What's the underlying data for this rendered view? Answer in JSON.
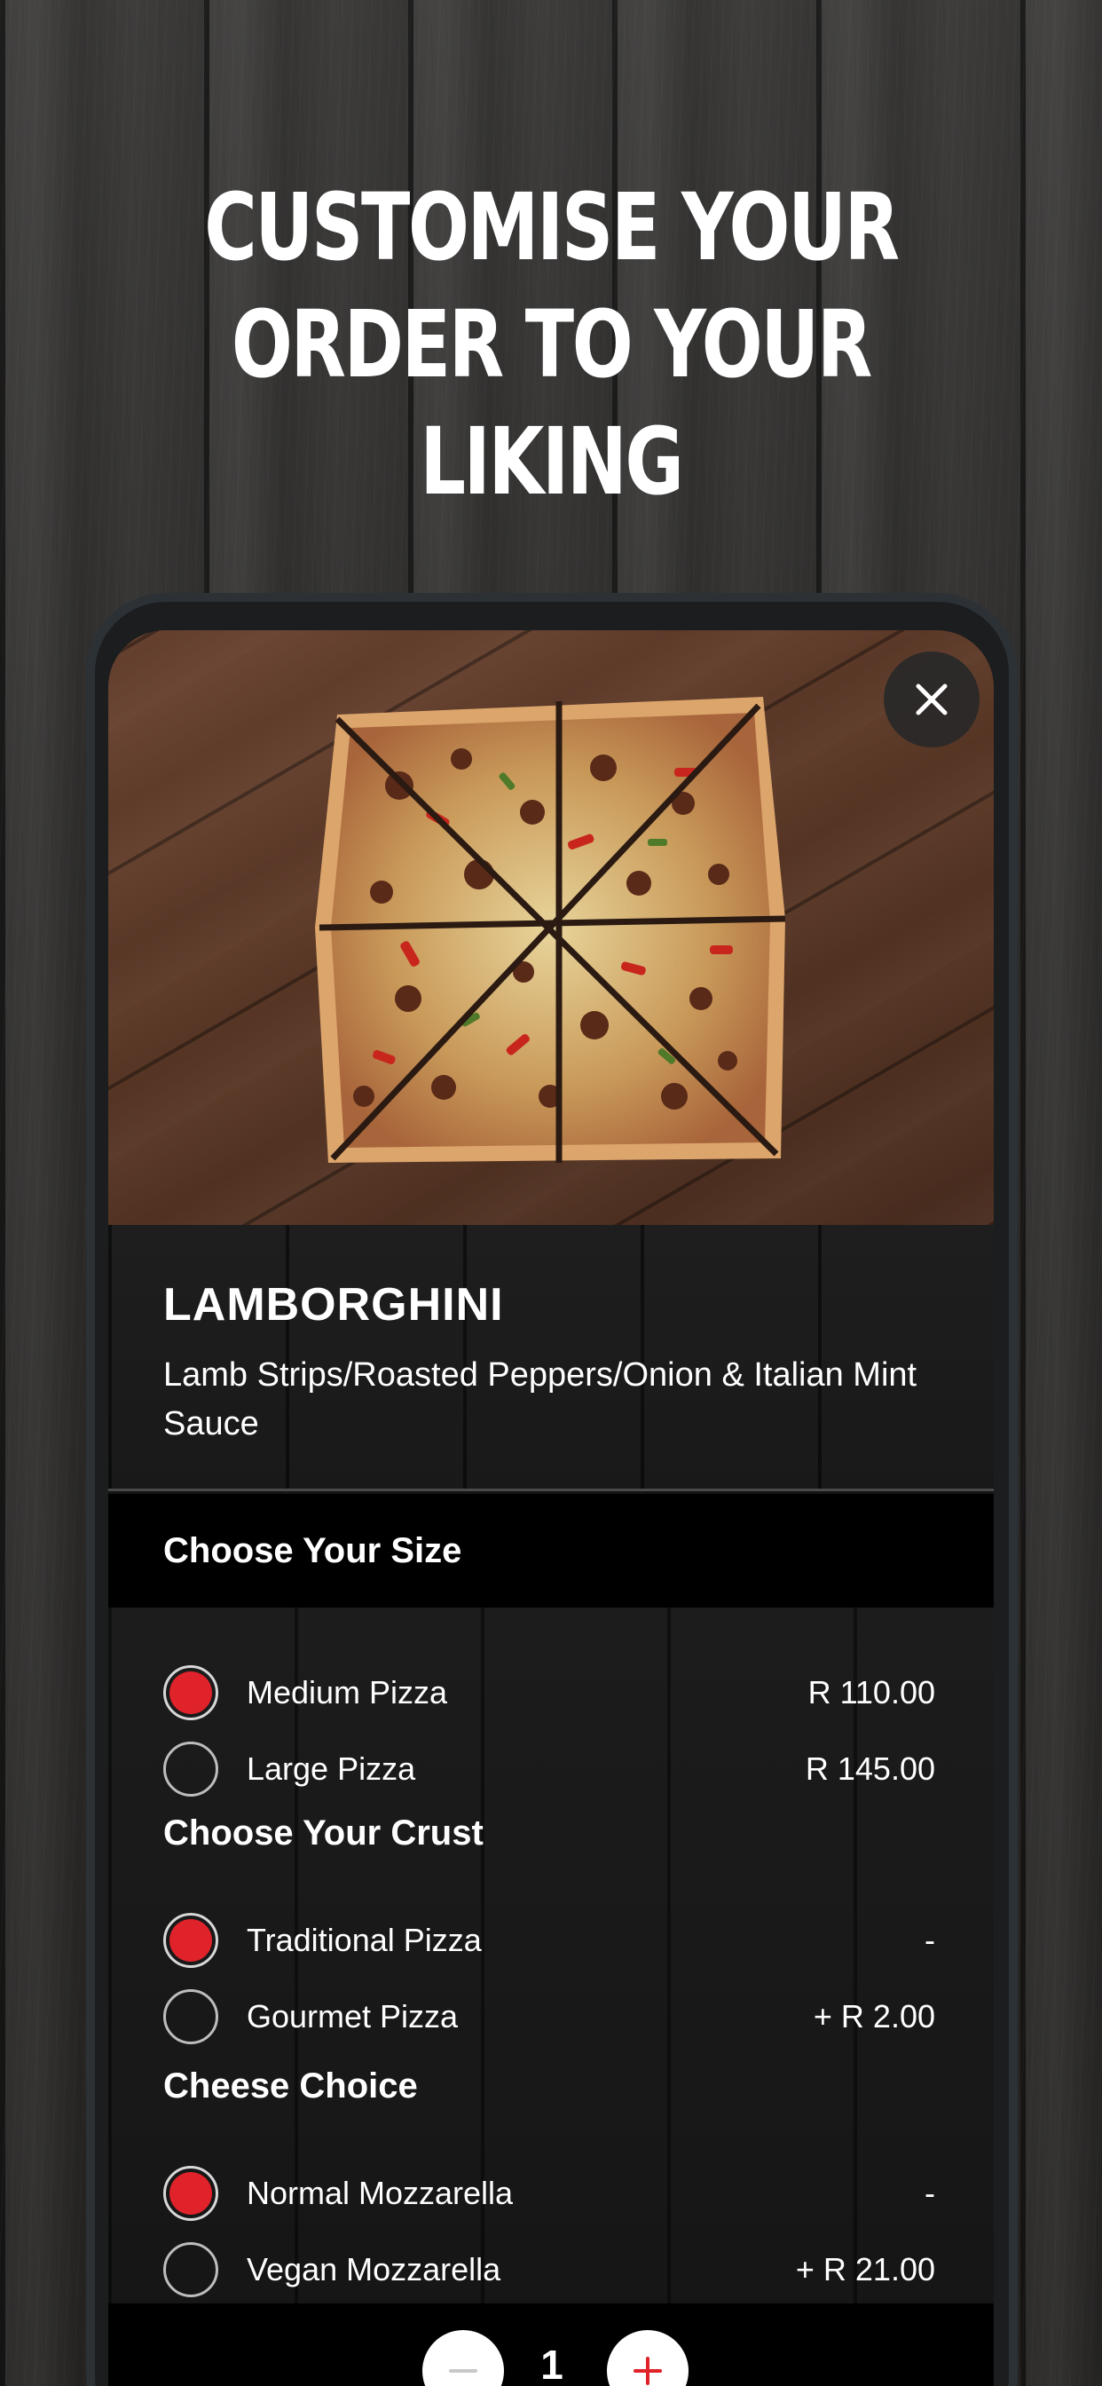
{
  "headline": "CUSTOMISE YOUR ORDER TO YOUR LIKING",
  "product": {
    "name": "LAMBORGHINI",
    "description": "Lamb Strips/Roasted Peppers/Onion & Italian Mint Sauce"
  },
  "close_icon": "close-icon",
  "sections": {
    "size": {
      "title": "Choose Your Size",
      "options": [
        {
          "label": "Medium Pizza",
          "price": "R 110.00",
          "selected": true
        },
        {
          "label": "Large Pizza",
          "price": "R 145.00",
          "selected": false
        }
      ]
    },
    "crust": {
      "title": "Choose Your Crust",
      "options": [
        {
          "label": "Traditional Pizza",
          "price": "-",
          "selected": true
        },
        {
          "label": "Gourmet Pizza",
          "price": "+ R 2.00",
          "selected": false
        }
      ]
    },
    "cheese": {
      "title": "Cheese Choice",
      "options": [
        {
          "label": "Normal Mozzarella",
          "price": "-",
          "selected": true
        },
        {
          "label": "Vegan Mozzarella",
          "price": "+ R 21.00",
          "selected": false
        }
      ]
    }
  },
  "quantity": {
    "value": "1",
    "minus_icon": "minus-icon",
    "plus_icon": "plus-icon"
  },
  "colors": {
    "accent": "#e0222a",
    "background": "#2b2a29",
    "bar": "#000000"
  }
}
